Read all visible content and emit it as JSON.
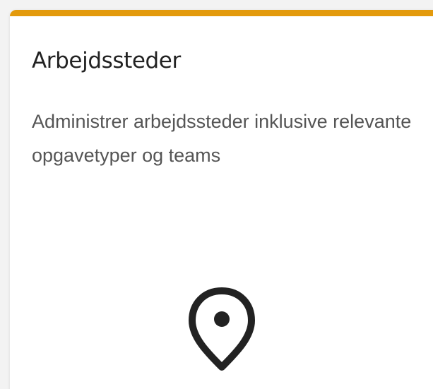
{
  "card": {
    "title": "Arbejdssteder",
    "description": "Administrer arbejdssteder inklusive relevante opgavetyper og teams",
    "icon": "map-pin-icon",
    "accent_color": "#e39a0c"
  }
}
